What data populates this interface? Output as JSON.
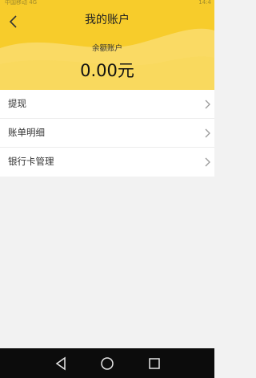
{
  "status_bar": {
    "left_text": "中国移动 4G",
    "right_text": "14:4"
  },
  "header": {
    "title": "我的账户",
    "balance_label": "余额账户",
    "balance_value": "0.00元",
    "colors": {
      "accent": "#f7cc2b",
      "wave": "#fbe07e"
    }
  },
  "menu": {
    "items": [
      {
        "label": "提现"
      },
      {
        "label": "账单明细"
      },
      {
        "label": "银行卡管理"
      }
    ]
  },
  "navigation": {
    "buttons": [
      "back-triangle-icon",
      "home-circle-icon",
      "recents-square-icon"
    ]
  }
}
